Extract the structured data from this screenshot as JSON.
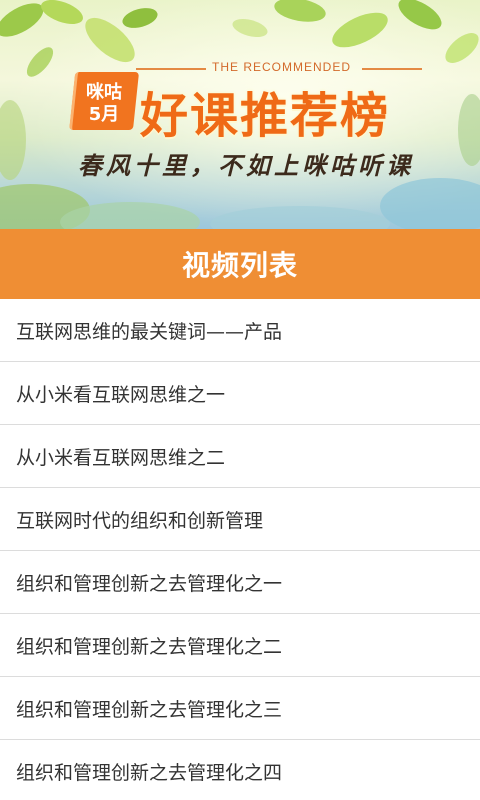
{
  "banner": {
    "badge_line1": "咪咕",
    "badge_line2": "5月",
    "recommended_text": "THE RECOMMENDED",
    "title": "好课推荐榜",
    "slogan": "春风十里，不如上咪咕听课"
  },
  "header": {
    "title": "视频列表",
    "background_color": "#ef8e34"
  },
  "video_list": [
    "互联网思维的最关键词——产品",
    "从小米看互联网思维之一",
    "从小米看互联网思维之二",
    "互联网时代的组织和创新管理",
    "组织和管理创新之去管理化之一",
    "组织和管理创新之去管理化之二",
    "组织和管理创新之去管理化之三",
    "组织和管理创新之去管理化之四"
  ]
}
